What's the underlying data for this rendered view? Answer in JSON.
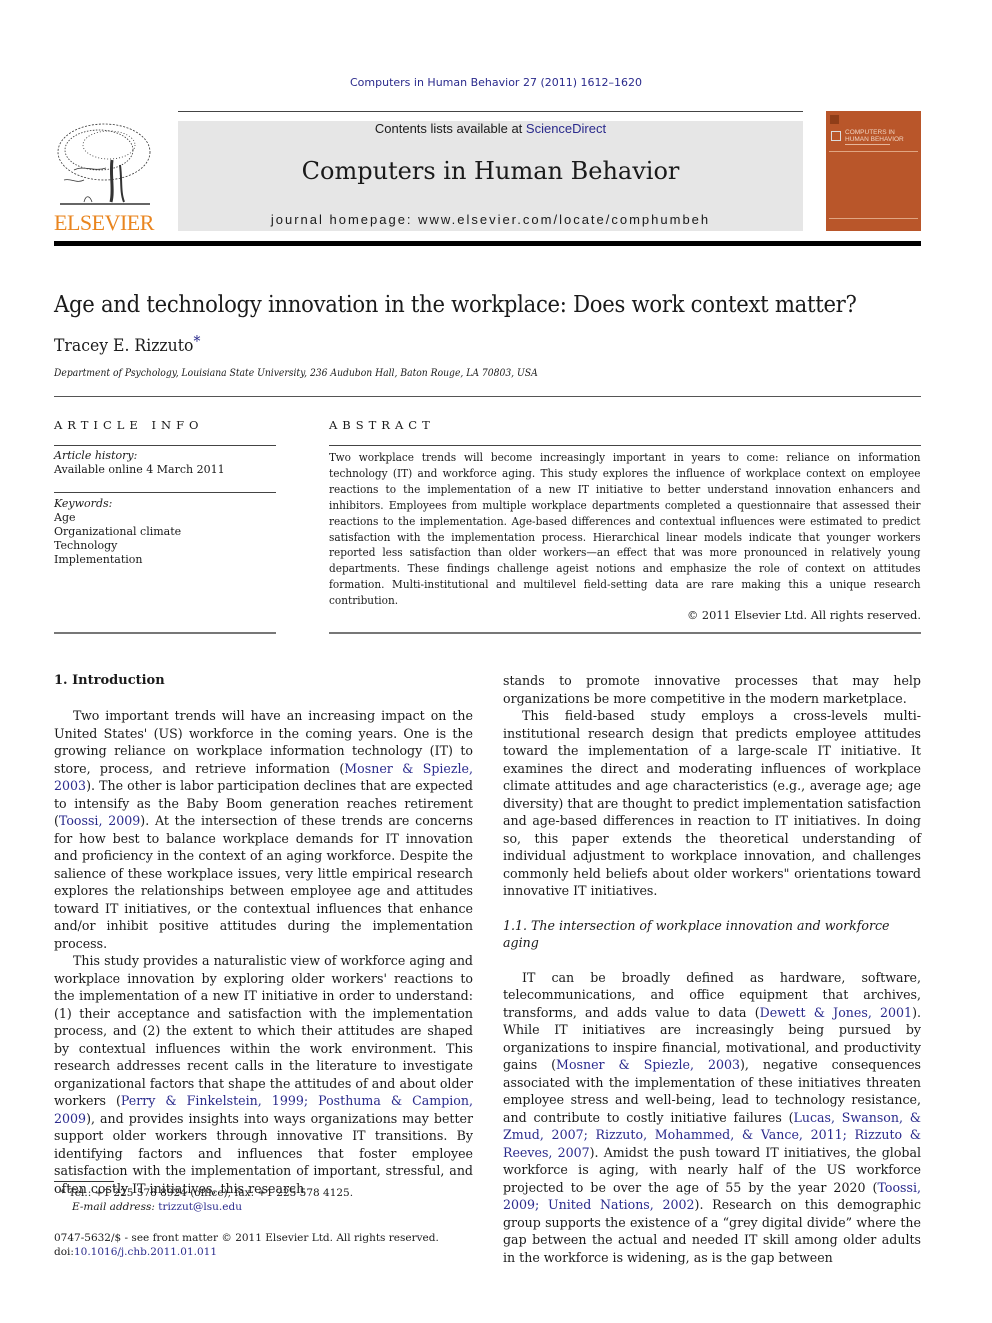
{
  "journal_ref": "Computers in Human Behavior 27 (2011) 1612–1620",
  "header": {
    "contents_prefix": "Contents lists available at ",
    "contents_link": "ScienceDirect",
    "journal_name": "Computers in Human Behavior",
    "homepage_prefix": "journal homepage: ",
    "homepage_url": "www.elsevier.com/locate/comphumbeh",
    "publisher_logo_text": "ELSEVIER",
    "cover_title_line1": "COMPUTERS IN",
    "cover_title_line2": "HUMAN BEHAVIOR"
  },
  "article": {
    "title": "Age and technology innovation in the workplace: Does work context matter?",
    "author": "Tracey E. Rizzuto",
    "author_mark": "*",
    "affiliation": "Department of Psychology, Louisiana State University, 236 Audubon Hall, Baton Rouge, LA 70803, USA"
  },
  "article_info": {
    "heading": "ARTICLE INFO",
    "history_label": "Article history:",
    "history_value": "Available online 4 March 2011",
    "keywords_label": "Keywords:",
    "keywords": [
      "Age",
      "Organizational climate",
      "Technology",
      "Implementation"
    ]
  },
  "abstract": {
    "heading": "ABSTRACT",
    "text": "Two workplace trends will become increasingly important in years to come: reliance on information technology (IT) and workforce aging. This study explores the influence of workplace context on employee reactions to the implementation of a new IT initiative to better understand innovation enhancers and inhibitors. Employees from multiple workplace departments completed a questionnaire that assessed their reactions to the implementation. Age-based differences and contextual influences were estimated to predict satisfaction with the implementation process. Hierarchical linear models indicate that younger workers reported less satisfaction than older workers—an effect that was more pronounced in relatively young departments. These findings challenge ageist notions and emphasize the role of context on attitudes formation. Multi-institutional and multilevel field-setting data are rare making this a unique research contribution.",
    "copyright": "© 2011 Elsevier Ltd. All rights reserved."
  },
  "intro": {
    "heading": "1. Introduction",
    "p1": {
      "a": "Two important trends will have an increasing impact on the United States' (US) workforce in the coming years. One is the growing reliance on workplace information technology (IT) to store, process, and retrieve information (",
      "c1": "Mosner & Spiezle, 2003",
      "b": "). The other is labor participation declines that are expected to intensify as the Baby Boom generation reaches retirement (",
      "c2": "Toossi, 2009",
      "c": "). At the intersection of these trends are concerns for how best to balance workplace demands for IT innovation and proficiency in the context of an aging workforce. Despite the salience of these workplace issues, very little empirical research explores the relationships between employee age and attitudes toward IT initiatives, or the contextual influences that enhance and/or inhibit positive attitudes during the implementation process."
    },
    "p2": {
      "a": "This study provides a naturalistic view of workforce aging and workplace innovation by exploring older workers' reactions to the implementation of a new IT initiative in order to understand: (1) their acceptance and satisfaction with the implementation process, and (2) the extent to which their attitudes are shaped by contextual influences within the work environment. This research addresses recent calls in the literature to investigate organizational factors that shape the attitudes of and about older workers (",
      "c1": "Perry & Finkelstein, 1999; Posthuma & Campion, 2009",
      "b": "), and provides insights into ways organizations may better support older workers through innovative IT transitions. By identifying factors and influences that foster employee satisfaction with the implementation of important, stressful, and often costly IT initiatives, this research stands to promote innovative processes that may help organizations be more competitive in the modern marketplace."
    },
    "p3": "This field-based study employs a cross-levels multi-institutional research design that predicts employee attitudes toward the implementation of a large-scale IT initiative. It examines the direct and moderating influences of workplace climate attitudes and age characteristics (e.g., average age; age diversity) that are thought to predict implementation satisfaction and age-based differences in reaction to IT initiatives. In doing so, this paper extends the theoretical understanding of individual adjustment to workplace innovation, and challenges commonly held beliefs about older workers\" orientations toward innovative IT initiatives.",
    "subsection_heading": "1.1. The intersection of workplace innovation and workforce aging",
    "p4": {
      "a": "IT can be broadly defined as hardware, software, telecommunications, and office equipment that archives, transforms, and adds value to data (",
      "c1": "Dewett & Jones, 2001",
      "b": "). While IT initiatives are increasingly being pursued by organizations to inspire financial, motivational, and productivity gains (",
      "c2": "Mosner & Spiezle, 2003",
      "c": "), negative consequences associated with the implementation of these initiatives threaten employee stress and well-being, lead to technology resistance, and contribute to costly initiative failures (",
      "c3": "Lucas, Swanson, & Zmud, 2007; Rizzuto, Mohammed, & Vance, 2011; Rizzuto & Reeves, 2007",
      "d": "). Amidst the push toward IT initiatives, the global workforce is aging, with nearly half of the US workforce projected to be over the age of 55 by the year 2020 (",
      "c4": "Toossi, 2009; United Nations, 2002",
      "e": "). Research on this demographic group supports the existence of a “grey digital divide” where the gap between the actual and needed IT skill among older adults in the workforce is widening, as is the gap between"
    }
  },
  "footnote": {
    "mark": "*",
    "contact": "Tel.: +1 225 578 8924 (office); fax: +1 225 578 4125.",
    "email_label": "E-mail address: ",
    "email": "trizzut@lsu.edu"
  },
  "front_matter": {
    "issn_line": "0747-5632/$ - see front matter © 2011 Elsevier Ltd. All rights reserved.",
    "doi_label": "doi:",
    "doi": "10.1016/j.chb.2011.01.011"
  },
  "colors": {
    "link": "#2a2a8c",
    "elsevier_orange": "#e9851f",
    "cover": "#b9562a",
    "banner_gray": "#e6e6e6"
  }
}
